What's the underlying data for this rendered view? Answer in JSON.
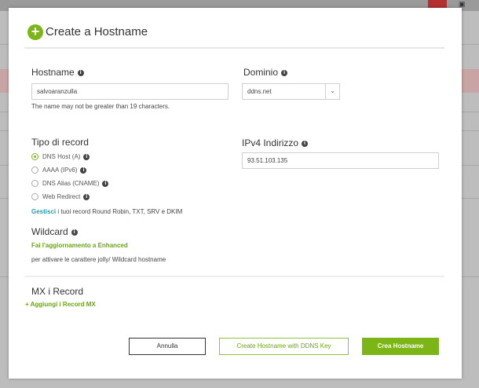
{
  "modal": {
    "title": "Create a Hostname",
    "hostname": {
      "label": "Hostname",
      "value": "salvoaranzulla",
      "hint": "The name may not be greater than 19 characters."
    },
    "domain": {
      "label": "Dominio",
      "value": "ddns.net"
    },
    "record_type": {
      "label": "Tipo di record",
      "options": [
        {
          "label": "DNS Host (A)",
          "selected": true
        },
        {
          "label": "AAAA (IPv6)",
          "selected": false
        },
        {
          "label": "DNS Alias (CNAME)",
          "selected": false
        },
        {
          "label": "Web Redirect",
          "selected": false
        }
      ],
      "manage_link": "Gestisci",
      "manage_text": "i tuoi record Round Robin, TXT, SRV e DKIM"
    },
    "ipv4": {
      "label": "IPv4 Indirizzo",
      "value": "93.51.103.135"
    },
    "wildcard": {
      "label": "Wildcard",
      "upgrade_link": "Fai l'aggiornamento a Enhanced",
      "upgrade_text": "per attivare le carattere jolly/ Wildcard hostname"
    },
    "mx": {
      "label": "MX i Record",
      "add_link": "+ Aggiungi i Record MX"
    },
    "buttons": {
      "cancel": "Annulla",
      "create_with_key": "Create Hostname with DDNS Key",
      "create": "Crea Hostname"
    }
  },
  "colors": {
    "accent": "#7cb516",
    "link_teal": "#1a9fb0"
  }
}
